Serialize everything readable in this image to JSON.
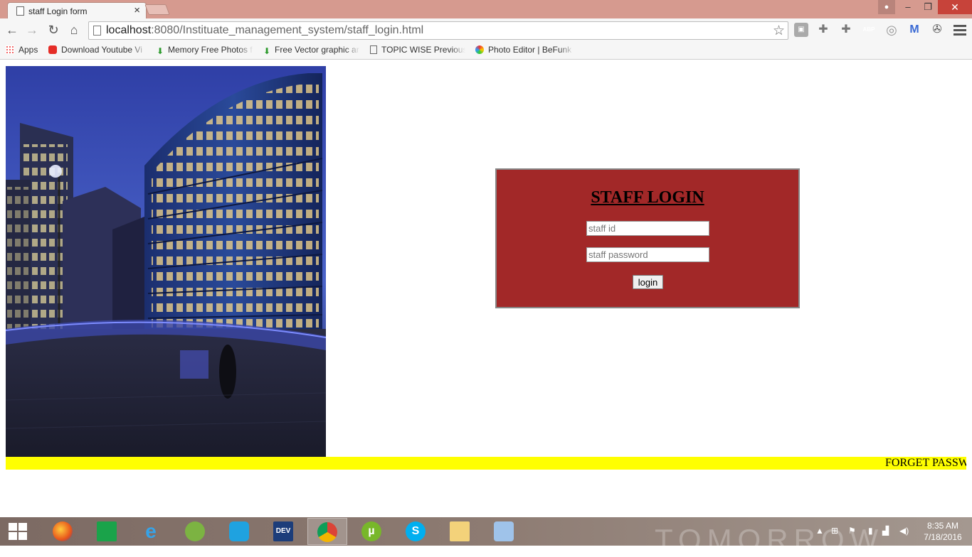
{
  "browser": {
    "tab_title": "staff Login form",
    "url_host": "localhost",
    "url_rest": ":8080/Instituate_management_system/staff_login.html",
    "bookmarks": [
      {
        "label": "Apps",
        "icon": "apps-grid-icon"
      },
      {
        "label": "Download Youtube Vi",
        "icon": "youtube-icon"
      },
      {
        "label": "Memory Free Photos f",
        "icon": "download-arrow-icon"
      },
      {
        "label": "Free Vector graphic ar",
        "icon": "download-arrow-icon"
      },
      {
        "label": "TOPIC WISE Previous",
        "icon": "page-icon"
      },
      {
        "label": "Photo Editor | BeFunk",
        "icon": "befunky-icon"
      }
    ],
    "extensions": [
      {
        "label": "ABP",
        "color": "#c70d0d"
      }
    ]
  },
  "login": {
    "title": "STAFF LOGIN",
    "staff_id_placeholder": "staff id",
    "staff_password_placeholder": "staff password",
    "button_label": "login",
    "box_color": "#a22828"
  },
  "marquee": {
    "text": "FORGET PASSWORD",
    "color": "#ffff00"
  },
  "taskbar": {
    "watermark": "TOMORROW",
    "apps": [
      "firefox-icon",
      "store-icon",
      "ie-icon",
      "android-studio-icon",
      "connect-icon",
      "dev-cpp-icon",
      "chrome-icon",
      "utorrent-icon",
      "skype-icon",
      "folder-icon",
      "virtualbox-icon"
    ],
    "time": "8:35 AM",
    "date": "7/18/2016"
  }
}
